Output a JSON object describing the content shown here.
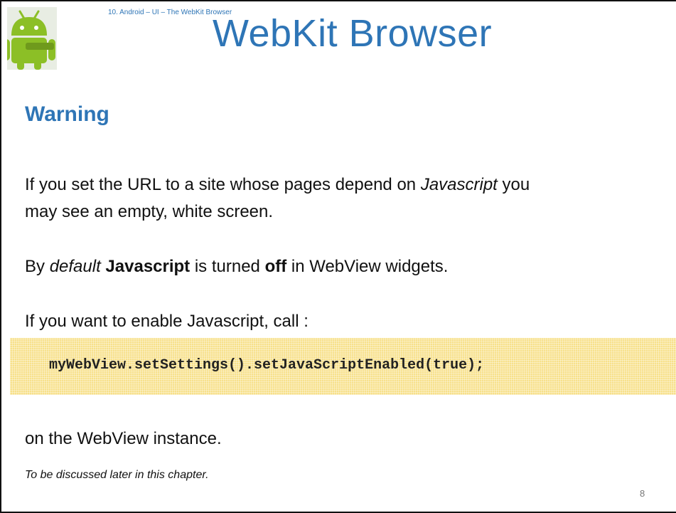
{
  "header": {
    "breadcrumb": "10. Android – UI – The WebKit Browser",
    "title": "WebKit Browser",
    "logo_icon": "android-robot-icon",
    "accent_color": "#2E75B6"
  },
  "content": {
    "heading": "Warning",
    "paragraph1": {
      "line1_before": "If you set the URL to a site whose pages depend on ",
      "line1_italic": "Javascript",
      "line1_after": " you",
      "line2": "may see an empty, white screen."
    },
    "paragraph2": {
      "by": "By ",
      "default_italic": "default",
      "space1": " ",
      "javascript_bold": "Javascript",
      "is_turned": " is turned ",
      "off_bold": "off",
      "rest": " in WebView widgets."
    },
    "paragraph3": "If you want to enable Javascript, call :",
    "code": "myWebView.setSettings().setJavaScriptEnabled(true);",
    "paragraph4": "on the WebView instance.",
    "note": "To be discussed later in this chapter."
  },
  "footer": {
    "page_number": "8"
  }
}
